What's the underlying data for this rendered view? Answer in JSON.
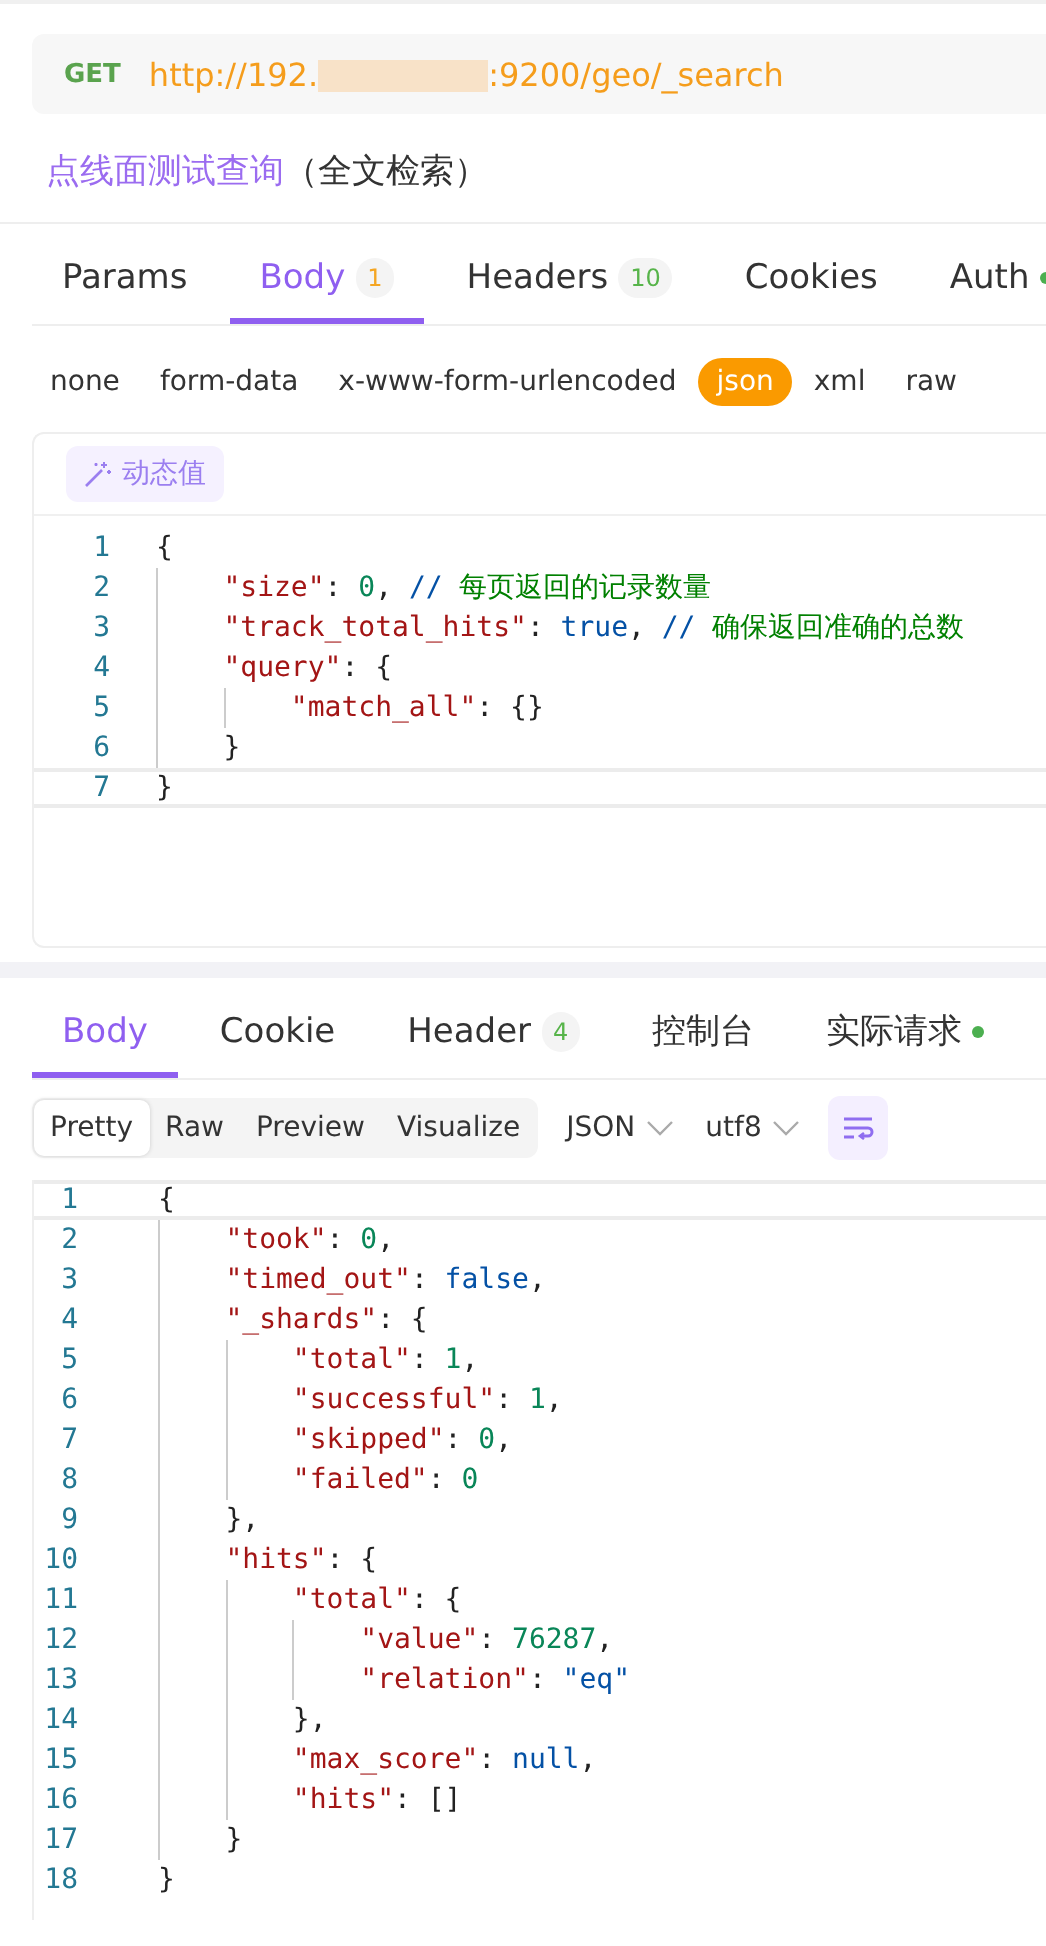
{
  "request": {
    "method": "GET",
    "url_start": "http://192.",
    "url_end": ":9200/geo/_search",
    "url_redacted": true
  },
  "title": {
    "name": "点线面测试查询",
    "note": "（全文检索）"
  },
  "request_tabs": [
    {
      "label": "Params",
      "selected": false
    },
    {
      "label": "Body",
      "badge": "1",
      "color": "#f5a623",
      "selected": true
    },
    {
      "label": "Headers",
      "badge": "10",
      "color": "#57b44a",
      "selected": false
    },
    {
      "label": "Cookies",
      "selected": false
    },
    {
      "label": "Auth",
      "dot": true,
      "selected": false
    }
  ],
  "body_types": [
    {
      "label": "none",
      "selected": false
    },
    {
      "label": "form-data",
      "selected": false
    },
    {
      "label": "x-www-form-urlencoded",
      "selected": false
    },
    {
      "label": "json",
      "selected": true
    },
    {
      "label": "xml",
      "selected": false
    },
    {
      "label": "raw",
      "selected": false
    }
  ],
  "dynamic_button": "动态值",
  "request_code": [
    {
      "number": "1",
      "current": false,
      "tokens": [
        {
          "kind": "punct",
          "text": "{"
        }
      ]
    },
    {
      "number": "2",
      "current": false,
      "tokens": [
        {
          "kind": "key",
          "text": "    \"size\""
        },
        {
          "kind": "punct",
          "text": ": "
        },
        {
          "kind": "num",
          "text": "0"
        },
        {
          "kind": "punct",
          "text": ", "
        },
        {
          "kind": "slash",
          "text": "//"
        },
        {
          "kind": "comment",
          "text": " 每页返回的记录数量"
        }
      ]
    },
    {
      "number": "3",
      "current": false,
      "tokens": [
        {
          "kind": "key",
          "text": "    \"track_total_hits\""
        },
        {
          "kind": "punct",
          "text": ": "
        },
        {
          "kind": "bool",
          "text": "true"
        },
        {
          "kind": "punct",
          "text": ", "
        },
        {
          "kind": "slash",
          "text": "//"
        },
        {
          "kind": "comment",
          "text": " 确保返回准确的总数"
        }
      ]
    },
    {
      "number": "4",
      "current": false,
      "tokens": [
        {
          "kind": "key",
          "text": "    \"query\""
        },
        {
          "kind": "punct",
          "text": ": {"
        }
      ]
    },
    {
      "number": "5",
      "current": false,
      "tokens": [
        {
          "kind": "key",
          "text": "        \"match_all\""
        },
        {
          "kind": "punct",
          "text": ": {}"
        }
      ]
    },
    {
      "number": "6",
      "current": false,
      "tokens": [
        {
          "kind": "punct",
          "text": "    }"
        }
      ]
    },
    {
      "number": "7",
      "current": true,
      "tokens": [
        {
          "kind": "punct",
          "text": "}"
        }
      ]
    }
  ],
  "response_tabs": [
    {
      "label": "Body",
      "selected": true
    },
    {
      "label": "Cookie",
      "selected": false
    },
    {
      "label": "Header",
      "badge": "4",
      "color": "#57b44a",
      "selected": false
    },
    {
      "label": "控制台",
      "selected": false
    },
    {
      "label": "实际请求",
      "dot": true,
      "selected": false
    }
  ],
  "view_modes": [
    {
      "label": "Pretty",
      "selected": true
    },
    {
      "label": "Raw",
      "selected": false
    },
    {
      "label": "Preview",
      "selected": false
    },
    {
      "label": "Visualize",
      "selected": false
    }
  ],
  "format_select": "JSON",
  "encoding_select": "utf8",
  "response_code": [
    {
      "number": "1",
      "current": true,
      "tokens": [
        {
          "kind": "punct",
          "text": "{"
        }
      ]
    },
    {
      "number": "2",
      "current": false,
      "tokens": [
        {
          "kind": "key",
          "text": "    \"took\""
        },
        {
          "kind": "punct",
          "text": ": "
        },
        {
          "kind": "num",
          "text": "0"
        },
        {
          "kind": "punct",
          "text": ","
        }
      ]
    },
    {
      "number": "3",
      "current": false,
      "tokens": [
        {
          "kind": "key",
          "text": "    \"timed_out\""
        },
        {
          "kind": "punct",
          "text": ": "
        },
        {
          "kind": "bool",
          "text": "false"
        },
        {
          "kind": "punct",
          "text": ","
        }
      ]
    },
    {
      "number": "4",
      "current": false,
      "tokens": [
        {
          "kind": "key",
          "text": "    \"_shards\""
        },
        {
          "kind": "punct",
          "text": ": {"
        }
      ]
    },
    {
      "number": "5",
      "current": false,
      "tokens": [
        {
          "kind": "key",
          "text": "        \"total\""
        },
        {
          "kind": "punct",
          "text": ": "
        },
        {
          "kind": "num",
          "text": "1"
        },
        {
          "kind": "punct",
          "text": ","
        }
      ]
    },
    {
      "number": "6",
      "current": false,
      "tokens": [
        {
          "kind": "key",
          "text": "        \"successful\""
        },
        {
          "kind": "punct",
          "text": ": "
        },
        {
          "kind": "num",
          "text": "1"
        },
        {
          "kind": "punct",
          "text": ","
        }
      ]
    },
    {
      "number": "7",
      "current": false,
      "tokens": [
        {
          "kind": "key",
          "text": "        \"skipped\""
        },
        {
          "kind": "punct",
          "text": ": "
        },
        {
          "kind": "num",
          "text": "0"
        },
        {
          "kind": "punct",
          "text": ","
        }
      ]
    },
    {
      "number": "8",
      "current": false,
      "tokens": [
        {
          "kind": "key",
          "text": "        \"failed\""
        },
        {
          "kind": "punct",
          "text": ": "
        },
        {
          "kind": "num",
          "text": "0"
        }
      ]
    },
    {
      "number": "9",
      "current": false,
      "tokens": [
        {
          "kind": "punct",
          "text": "    },"
        }
      ]
    },
    {
      "number": "10",
      "current": false,
      "tokens": [
        {
          "kind": "key",
          "text": "    \"hits\""
        },
        {
          "kind": "punct",
          "text": ": {"
        }
      ]
    },
    {
      "number": "11",
      "current": false,
      "tokens": [
        {
          "kind": "key",
          "text": "        \"total\""
        },
        {
          "kind": "punct",
          "text": ": {"
        }
      ]
    },
    {
      "number": "12",
      "current": false,
      "tokens": [
        {
          "kind": "key",
          "text": "            \"value\""
        },
        {
          "kind": "punct",
          "text": ": "
        },
        {
          "kind": "num",
          "text": "76287"
        },
        {
          "kind": "punct",
          "text": ","
        }
      ]
    },
    {
      "number": "13",
      "current": false,
      "tokens": [
        {
          "kind": "key",
          "text": "            \"relation\""
        },
        {
          "kind": "punct",
          "text": ": "
        },
        {
          "kind": "str",
          "text": "\"eq\""
        }
      ]
    },
    {
      "number": "14",
      "current": false,
      "tokens": [
        {
          "kind": "punct",
          "text": "        },"
        }
      ]
    },
    {
      "number": "15",
      "current": false,
      "tokens": [
        {
          "kind": "key",
          "text": "        \"max_score\""
        },
        {
          "kind": "punct",
          "text": ": "
        },
        {
          "kind": "bool",
          "text": "null"
        },
        {
          "kind": "punct",
          "text": ","
        }
      ]
    },
    {
      "number": "16",
      "current": false,
      "tokens": [
        {
          "kind": "key",
          "text": "        \"hits\""
        },
        {
          "kind": "punct",
          "text": ": []"
        }
      ]
    },
    {
      "number": "17",
      "current": false,
      "tokens": [
        {
          "kind": "punct",
          "text": "    }"
        }
      ]
    },
    {
      "number": "18",
      "current": false,
      "tokens": [
        {
          "kind": "punct",
          "text": "}"
        }
      ]
    }
  ]
}
